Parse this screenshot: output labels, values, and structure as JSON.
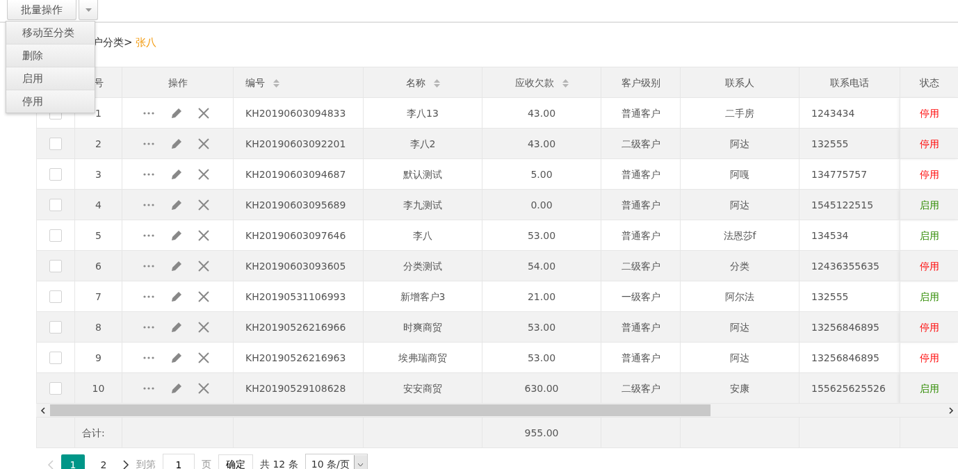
{
  "toolbar": {
    "batch_button": "批量操作"
  },
  "batch_menu": [
    "移动至分类",
    "删除",
    "启用",
    "停用"
  ],
  "breadcrumb": {
    "path": "户分类>",
    "current": "张八"
  },
  "table": {
    "columns": [
      {
        "label": "号",
        "sortable": false
      },
      {
        "label": "操作",
        "sortable": false
      },
      {
        "label": "编号",
        "sortable": true
      },
      {
        "label": "名称",
        "sortable": true
      },
      {
        "label": "应收欠款",
        "sortable": true
      },
      {
        "label": "客户级别",
        "sortable": false
      },
      {
        "label": "联系人",
        "sortable": false
      },
      {
        "label": "联系电话",
        "sortable": false
      },
      {
        "label": "状态",
        "sortable": false
      }
    ],
    "rows": [
      {
        "checked": false,
        "index": "1",
        "code": "KH20190603094833",
        "name": "李八13",
        "debt": "43.00",
        "level": "普通客户",
        "contact": "二手房",
        "phone": "1243434",
        "status": "停用",
        "enabled": false
      },
      {
        "checked": false,
        "index": "2",
        "code": "KH20190603092201",
        "name": "李八2",
        "debt": "43.00",
        "level": "二级客户",
        "contact": "阿达",
        "phone": "132555",
        "status": "停用",
        "enabled": false
      },
      {
        "checked": false,
        "index": "3",
        "code": "KH20190603094687",
        "name": "默认测试",
        "debt": "5.00",
        "level": "普通客户",
        "contact": "阿嘎",
        "phone": "134775757",
        "status": "停用",
        "enabled": false
      },
      {
        "checked": false,
        "index": "4",
        "code": "KH20190603095689",
        "name": "李九测试",
        "debt": "0.00",
        "level": "普通客户",
        "contact": "阿达",
        "phone": "1545122515",
        "status": "启用",
        "enabled": true
      },
      {
        "checked": false,
        "index": "5",
        "code": "KH20190603097646",
        "name": "李八",
        "debt": "53.00",
        "level": "普通客户",
        "contact": "法恩莎f",
        "phone": "134534",
        "status": "启用",
        "enabled": true
      },
      {
        "checked": false,
        "index": "6",
        "code": "KH20190603093605",
        "name": "分类测试",
        "debt": "54.00",
        "level": "二级客户",
        "contact": "分类",
        "phone": "12436355635",
        "status": "停用",
        "enabled": false
      },
      {
        "checked": false,
        "index": "7",
        "code": "KH20190531106993",
        "name": "新增客户3",
        "debt": "21.00",
        "level": "一级客户",
        "contact": "阿尔法",
        "phone": "132555",
        "status": "启用",
        "enabled": true
      },
      {
        "checked": false,
        "index": "8",
        "code": "KH20190526216966",
        "name": "时爽商贸",
        "debt": "53.00",
        "level": "普通客户",
        "contact": "阿达",
        "phone": "13256846895",
        "status": "停用",
        "enabled": false
      },
      {
        "checked": false,
        "index": "9",
        "code": "KH20190526216963",
        "name": "埃弗瑞商贸",
        "debt": "53.00",
        "level": "普通客户",
        "contact": "阿达",
        "phone": "13256846895",
        "status": "停用",
        "enabled": false
      },
      {
        "checked": false,
        "index": "10",
        "code": "KH20190529108628",
        "name": "安安商贸",
        "debt": "630.00",
        "level": "二级客户",
        "contact": "安康",
        "phone": "155625625526",
        "status": "启用",
        "enabled": true
      }
    ],
    "footer": {
      "label": "合计:",
      "debt_total": "955.00"
    }
  },
  "pagination": {
    "pages": [
      {
        "label": "1",
        "selected": true
      },
      {
        "label": "2",
        "selected": false
      }
    ],
    "goto_label": "到第",
    "goto_value": "1",
    "page_unit": "页",
    "confirm": "确定",
    "total": "共 12 条",
    "page_size": "10 条/页"
  }
}
